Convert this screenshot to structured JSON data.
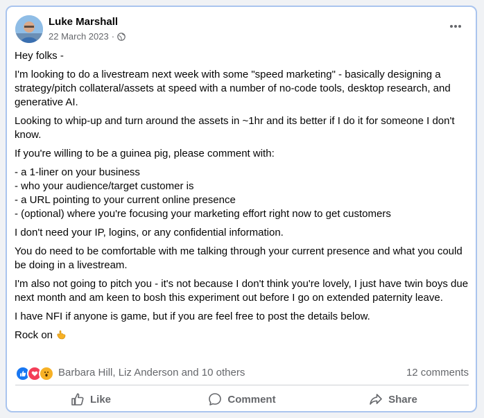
{
  "post": {
    "author": "Luke Marshall",
    "date": "22 March 2023",
    "separator": "·",
    "audience_icon": "globe-icon",
    "more_icon": "more-options-icon",
    "paragraphs": {
      "p1": "Hey folks -",
      "p2": "I'm looking to do a livestream next week with some \"speed marketing\" - basically designing a strategy/pitch collateral/assets at speed with a number of no-code tools, desktop research, and generative AI.",
      "p3": "Looking to whip-up and turn around the assets in ~1hr and its better if I do it for someone I don't know.",
      "p4": "If you're willing to be a guinea pig, please comment with:",
      "p6": "I don't need your IP, logins, or any confidential information.",
      "p7": "You do need to be comfortable with me talking through your current presence and what you could be doing in a livestream.",
      "p8": "I'm also not going to pitch you - it's not because I don't think you're lovely, I just have twin boys due next month and am keen to bosh this experiment out before I go on extended paternity leave.",
      "p9": "I have NFI if anyone is game, but if you are feel free to post the details below.",
      "p10": "Rock on"
    },
    "list": [
      "- a 1-liner on your business",
      "- who your audience/target customer is",
      "- a URL pointing to your current online presence",
      "- (optional) where you're focusing your marketing effort right now to get customers"
    ],
    "closing_emoji": "call-me-hand-emoji"
  },
  "reactions": {
    "icons": [
      "like-reaction-icon",
      "love-reaction-icon",
      "wow-reaction-icon"
    ],
    "text": "Barbara Hill, Liz Anderson and 10 others",
    "comments": "12 comments"
  },
  "actions": {
    "like": "Like",
    "comment": "Comment",
    "share": "Share"
  },
  "colors": {
    "border": "#a9c4ee",
    "like_blue": "#1877f2",
    "love_red": "#f33e58",
    "wow_yellow": "#f7b125",
    "secondary_text": "#65676b"
  }
}
